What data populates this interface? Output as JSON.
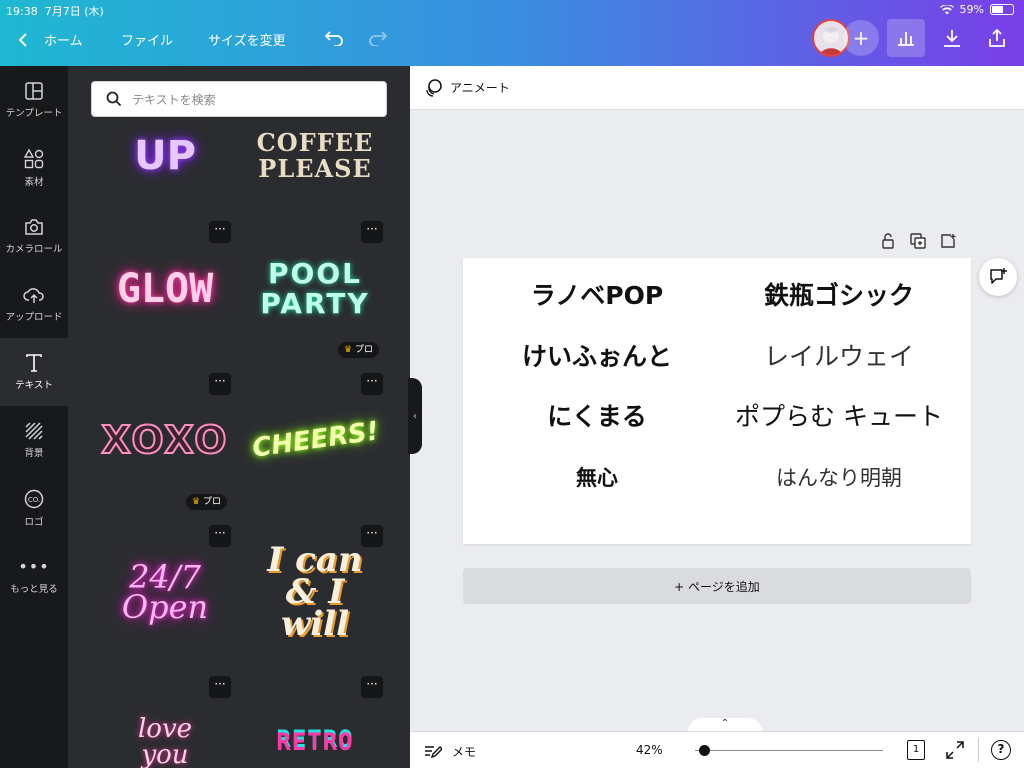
{
  "status": {
    "time": "19:38",
    "date": "7月7日 (木)",
    "battery": "59%"
  },
  "toolbar": {
    "home": "ホーム",
    "file": "ファイル",
    "resize": "サイズを変更"
  },
  "sidebar": {
    "items": [
      {
        "label": "テンプレート"
      },
      {
        "label": "素材"
      },
      {
        "label": "カメラロール"
      },
      {
        "label": "アップロード"
      },
      {
        "label": "テキスト"
      },
      {
        "label": "背景"
      },
      {
        "label": "ロゴ"
      },
      {
        "label": "もっと見る"
      }
    ]
  },
  "panel": {
    "search_placeholder": "テキストを検索",
    "more_label": "···",
    "pro_label": "プロ",
    "tiles": [
      {
        "text": "UP"
      },
      {
        "text": "COFFEE PLEASE"
      },
      {
        "text": "GLOW"
      },
      {
        "text": "POOL PARTY"
      },
      {
        "text": "XOXO"
      },
      {
        "text": "CHEERS!"
      },
      {
        "text": "24/7 Open"
      },
      {
        "text": "I can & I will"
      },
      {
        "text": "love you"
      },
      {
        "text": "RETRO"
      }
    ]
  },
  "editor": {
    "animate_label": "アニメート",
    "add_page": "+ ページを追加"
  },
  "canvas": {
    "fonts": [
      "ラノベPOP",
      "鉄瓶ゴシック",
      "けいふぉんと",
      "レイルウェイ",
      "にくまる",
      "ポプらむ キュート",
      "無心",
      "はんなり明朝"
    ]
  },
  "bottom": {
    "memo": "メモ",
    "zoom": "42%",
    "zoom_level": 0.05,
    "page_count": "1"
  },
  "colors": {
    "gradient_start": "#1fb8d2",
    "gradient_end": "#7a3ee8",
    "panel_bg": "#2b2c30",
    "sidebar_bg": "#18191b"
  }
}
